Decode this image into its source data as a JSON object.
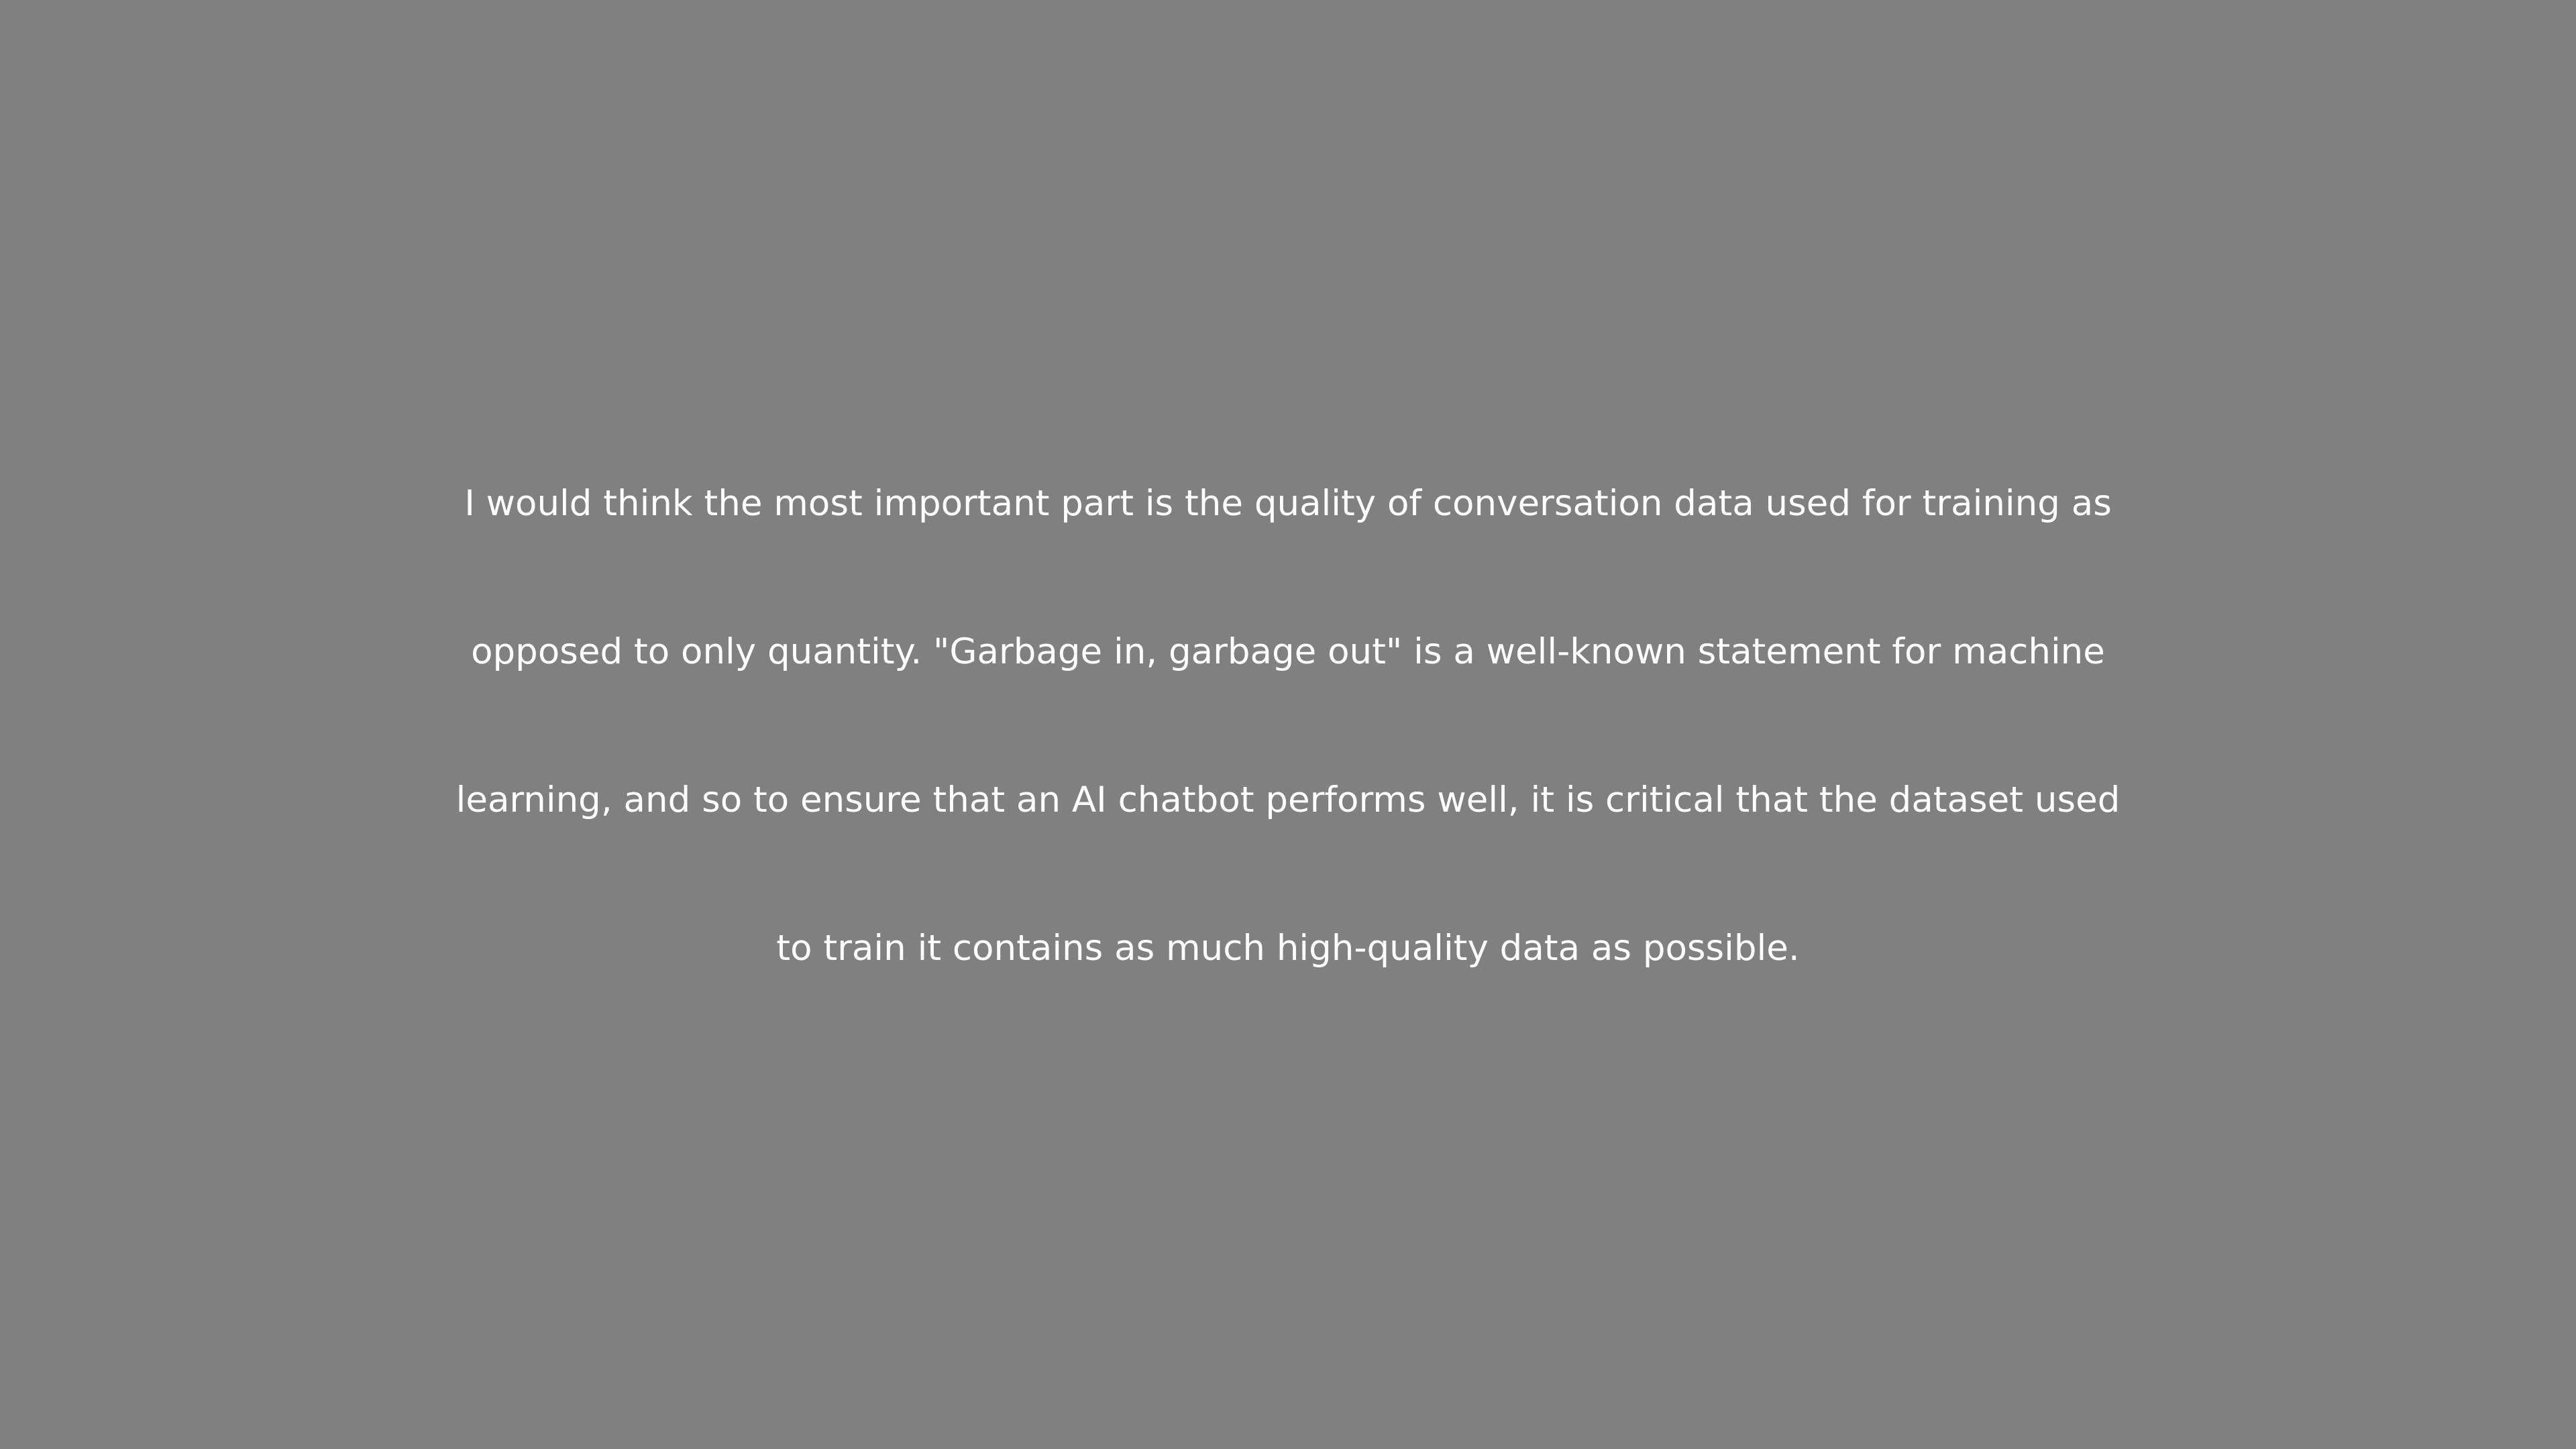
{
  "caption": {
    "lines": [
      "I would think the most important part is the quality of conversation data used for training as",
      "opposed to only quantity. \"Garbage in, garbage out\" is a well-known statement for machine",
      "learning, and so to ensure that an AI chatbot performs well, it is critical that the dataset used",
      "to train it contains as much high-quality data as possible."
    ]
  },
  "colors": {
    "background": "#808080",
    "text": "#ffffff"
  }
}
